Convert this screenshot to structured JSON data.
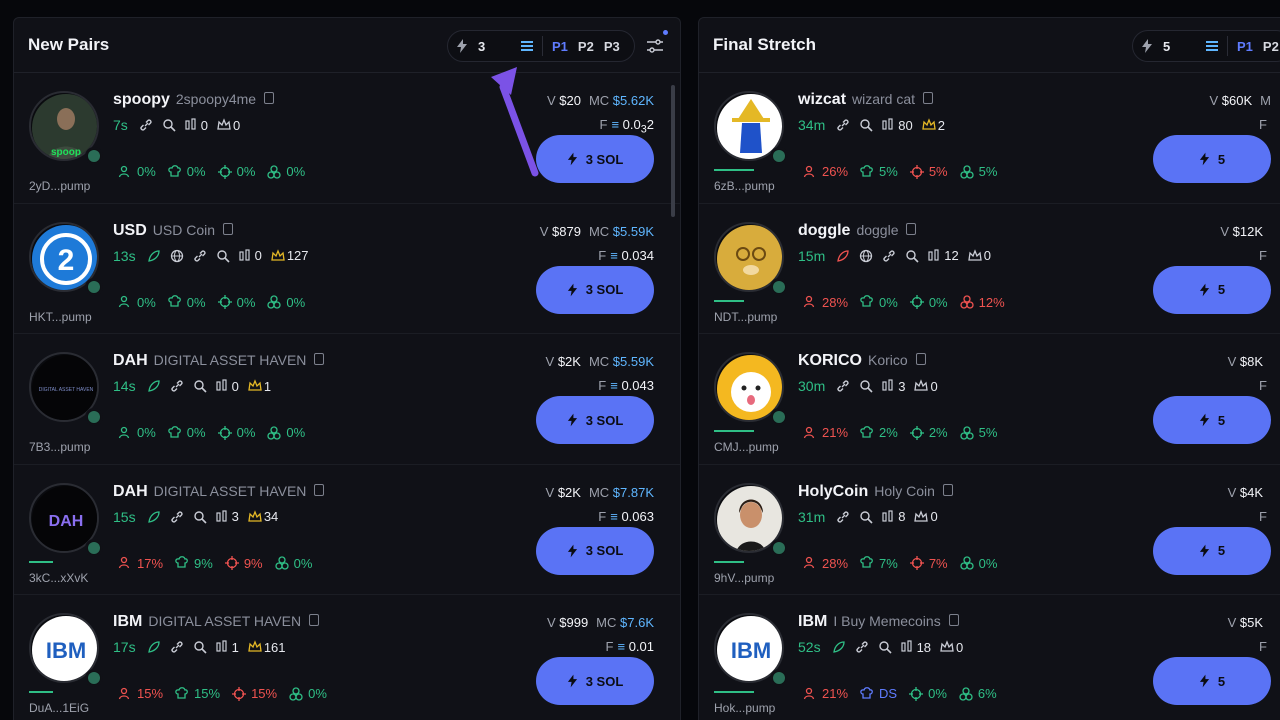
{
  "colors": {
    "accent": "#5a73f5",
    "green": "#2fbf86",
    "red": "#ef5350",
    "blue": "#5f7cff",
    "mc": "#5fb6ff"
  },
  "left": {
    "title": "New Pairs",
    "quick_buy_amount": "3",
    "presets": [
      "P1",
      "P2",
      "P3"
    ],
    "rows": [
      {
        "ticker": "spoopy",
        "name": "2spoopy4me",
        "age": "7s",
        "holders": "0",
        "pro": "0",
        "v": "$20",
        "mc": "$5.62K",
        "f_pre": "0.0",
        "f_sub": "3",
        "f_post": "2",
        "buy": "3 SOL",
        "addr": "2yD...pump",
        "stats": [
          {
            "v": "0%",
            "c": "green",
            "icon": "user-icon"
          },
          {
            "v": "0%",
            "c": "green",
            "icon": "chef-hat-icon"
          },
          {
            "v": "0%",
            "c": "green",
            "icon": "crosshair-icon"
          },
          {
            "v": "0%",
            "c": "green",
            "icon": "cluster-icon"
          }
        ]
      },
      {
        "ticker": "USD",
        "name": "USD Coin",
        "age": "13s",
        "holders": "0",
        "pro": "127",
        "v": "$879",
        "mc": "$5.59K",
        "f_pre": "0.034",
        "buy": "3 SOL",
        "addr": "HKT...pump",
        "stats": [
          {
            "v": "0%",
            "c": "green",
            "icon": "user-icon"
          },
          {
            "v": "0%",
            "c": "green",
            "icon": "chef-hat-icon"
          },
          {
            "v": "0%",
            "c": "green",
            "icon": "crosshair-icon"
          },
          {
            "v": "0%",
            "c": "green",
            "icon": "cluster-icon"
          }
        ]
      },
      {
        "ticker": "DAH",
        "name": "DIGITAL ASSET HAVEN",
        "age": "14s",
        "holders": "0",
        "pro": "1",
        "v": "$2K",
        "mc": "$5.59K",
        "f_pre": "0.043",
        "buy": "3 SOL",
        "addr": "7B3...pump",
        "stats": [
          {
            "v": "0%",
            "c": "green",
            "icon": "user-icon"
          },
          {
            "v": "0%",
            "c": "green",
            "icon": "chef-hat-icon"
          },
          {
            "v": "0%",
            "c": "green",
            "icon": "crosshair-icon"
          },
          {
            "v": "0%",
            "c": "green",
            "icon": "cluster-icon"
          }
        ]
      },
      {
        "ticker": "DAH",
        "name": "DIGITAL ASSET HAVEN",
        "age": "15s",
        "holders": "3",
        "pro": "34",
        "v": "$2K",
        "mc": "$7.87K",
        "f_pre": "0.063",
        "buy": "3 SOL",
        "addr": "3kC...xXvK",
        "stats": [
          {
            "v": "17%",
            "c": "red",
            "icon": "user-icon"
          },
          {
            "v": "9%",
            "c": "green",
            "icon": "chef-hat-icon"
          },
          {
            "v": "9%",
            "c": "red",
            "icon": "crosshair-icon"
          },
          {
            "v": "0%",
            "c": "green",
            "icon": "cluster-icon"
          }
        ]
      },
      {
        "ticker": "IBM",
        "name": "DIGITAL ASSET HAVEN",
        "age": "17s",
        "holders": "1",
        "pro": "161",
        "v": "$999",
        "mc": "$7.6K",
        "f_pre": "0.01",
        "buy": "3 SOL",
        "addr": "DuA...1EiG",
        "stats": [
          {
            "v": "15%",
            "c": "red",
            "icon": "user-icon"
          },
          {
            "v": "15%",
            "c": "green",
            "icon": "chef-hat-icon"
          },
          {
            "v": "15%",
            "c": "red",
            "icon": "crosshair-icon"
          },
          {
            "v": "0%",
            "c": "green",
            "icon": "cluster-icon"
          }
        ]
      }
    ]
  },
  "right": {
    "title": "Final Stretch",
    "quick_buy_amount": "5",
    "presets": [
      "P1",
      "P2"
    ],
    "rows": [
      {
        "ticker": "wizcat",
        "name": "wizard cat",
        "age": "34m",
        "holders": "80",
        "pro": "2",
        "v": "$60K",
        "mc": "M",
        "f_pre": "F",
        "buy": "5",
        "addr": "6zB...pump",
        "stats": [
          {
            "v": "26%",
            "c": "red",
            "icon": "user-icon"
          },
          {
            "v": "5%",
            "c": "green",
            "icon": "chef-hat-icon"
          },
          {
            "v": "5%",
            "c": "red",
            "icon": "crosshair-icon"
          },
          {
            "v": "5%",
            "c": "green",
            "icon": "cluster-icon"
          }
        ]
      },
      {
        "ticker": "doggle",
        "name": "doggle",
        "age": "15m",
        "holders": "12",
        "pro": "0",
        "v": "$12K",
        "mc": "",
        "f_pre": "F",
        "buy": "5",
        "addr": "NDT...pump",
        "stats": [
          {
            "v": "28%",
            "c": "red",
            "icon": "user-icon"
          },
          {
            "v": "0%",
            "c": "green",
            "icon": "chef-hat-icon"
          },
          {
            "v": "0%",
            "c": "green",
            "icon": "crosshair-icon"
          },
          {
            "v": "12%",
            "c": "red",
            "icon": "cluster-icon"
          }
        ]
      },
      {
        "ticker": "KORICO",
        "name": "Korico",
        "age": "30m",
        "holders": "3",
        "pro": "0",
        "v": "$8K",
        "mc": "",
        "f_pre": "F",
        "buy": "5",
        "addr": "CMJ...pump",
        "stats": [
          {
            "v": "21%",
            "c": "red",
            "icon": "user-icon"
          },
          {
            "v": "2%",
            "c": "green",
            "icon": "chef-hat-icon"
          },
          {
            "v": "2%",
            "c": "green",
            "icon": "crosshair-icon"
          },
          {
            "v": "5%",
            "c": "green",
            "icon": "cluster-icon"
          }
        ]
      },
      {
        "ticker": "HolyCoin",
        "name": "Holy Coin",
        "age": "31m",
        "holders": "8",
        "pro": "0",
        "v": "$4K",
        "mc": "",
        "f_pre": "F",
        "buy": "5",
        "addr": "9hV...pump",
        "stats": [
          {
            "v": "28%",
            "c": "red",
            "icon": "user-icon"
          },
          {
            "v": "7%",
            "c": "green",
            "icon": "chef-hat-icon"
          },
          {
            "v": "7%",
            "c": "red",
            "icon": "crosshair-icon"
          },
          {
            "v": "0%",
            "c": "green",
            "icon": "cluster-icon"
          }
        ]
      },
      {
        "ticker": "IBM",
        "name": "I Buy Memecoins",
        "age": "52s",
        "holders": "18",
        "pro": "0",
        "v": "$5K",
        "mc": "",
        "f_pre": "F",
        "buy": "5",
        "addr": "Hok...pump",
        "stats": [
          {
            "v": "21%",
            "c": "red",
            "icon": "user-icon"
          },
          {
            "v": "DS",
            "c": "blue",
            "icon": "chef-hat-icon"
          },
          {
            "v": "0%",
            "c": "green",
            "icon": "crosshair-icon"
          },
          {
            "v": "6%",
            "c": "green",
            "icon": "cluster-icon"
          }
        ]
      }
    ]
  }
}
